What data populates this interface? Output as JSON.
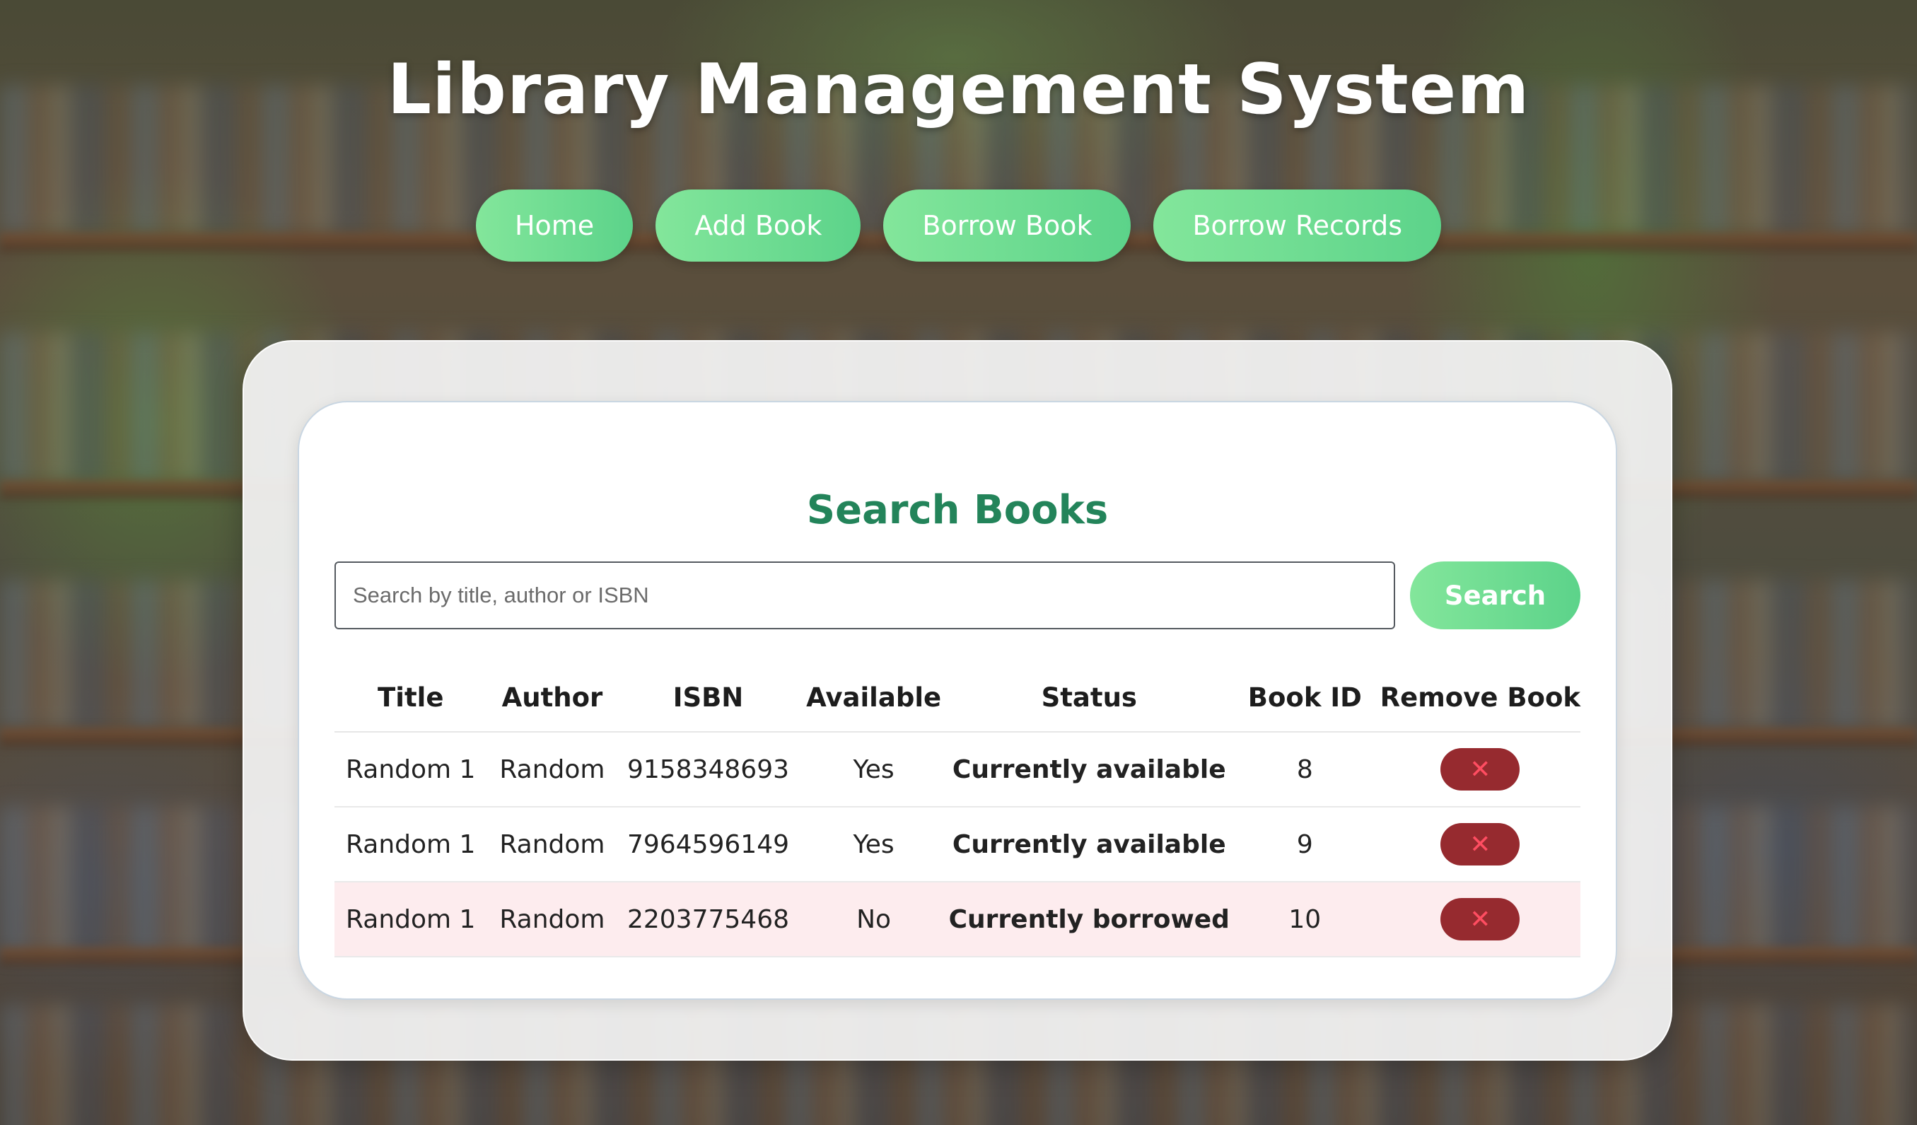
{
  "app": {
    "title": "Library Management System"
  },
  "nav": {
    "items": [
      {
        "label": "Home"
      },
      {
        "label": "Add Book"
      },
      {
        "label": "Borrow Book"
      },
      {
        "label": "Borrow Records"
      }
    ]
  },
  "search": {
    "title": "Search Books",
    "placeholder": "Search by title, author or ISBN",
    "value": "",
    "button_label": "Search"
  },
  "table": {
    "headers": [
      "Title",
      "Author",
      "ISBN",
      "Available",
      "Status",
      "Book ID",
      "Remove Book"
    ],
    "rows": [
      {
        "title": "Random 1",
        "author": "Random",
        "isbn": "9158348693",
        "available": "Yes",
        "status": "Currently available",
        "book_id": "8",
        "remove": "✕"
      },
      {
        "title": "Random 1",
        "author": "Random",
        "isbn": "7964596149",
        "available": "Yes",
        "status": "Currently available",
        "book_id": "9",
        "remove": "✕"
      },
      {
        "title": "Random 1",
        "author": "Random",
        "isbn": "2203775468",
        "available": "No",
        "status": "Currently borrowed",
        "book_id": "10",
        "remove": "✕"
      }
    ]
  },
  "colors": {
    "accent_green": "#5cd38a",
    "title_green": "#23845a",
    "available_text": "#2e8b3a",
    "borrowed_text": "#c62828",
    "borrowed_row_bg": "#fdecee",
    "remove_button_bg": "#962a2f"
  }
}
